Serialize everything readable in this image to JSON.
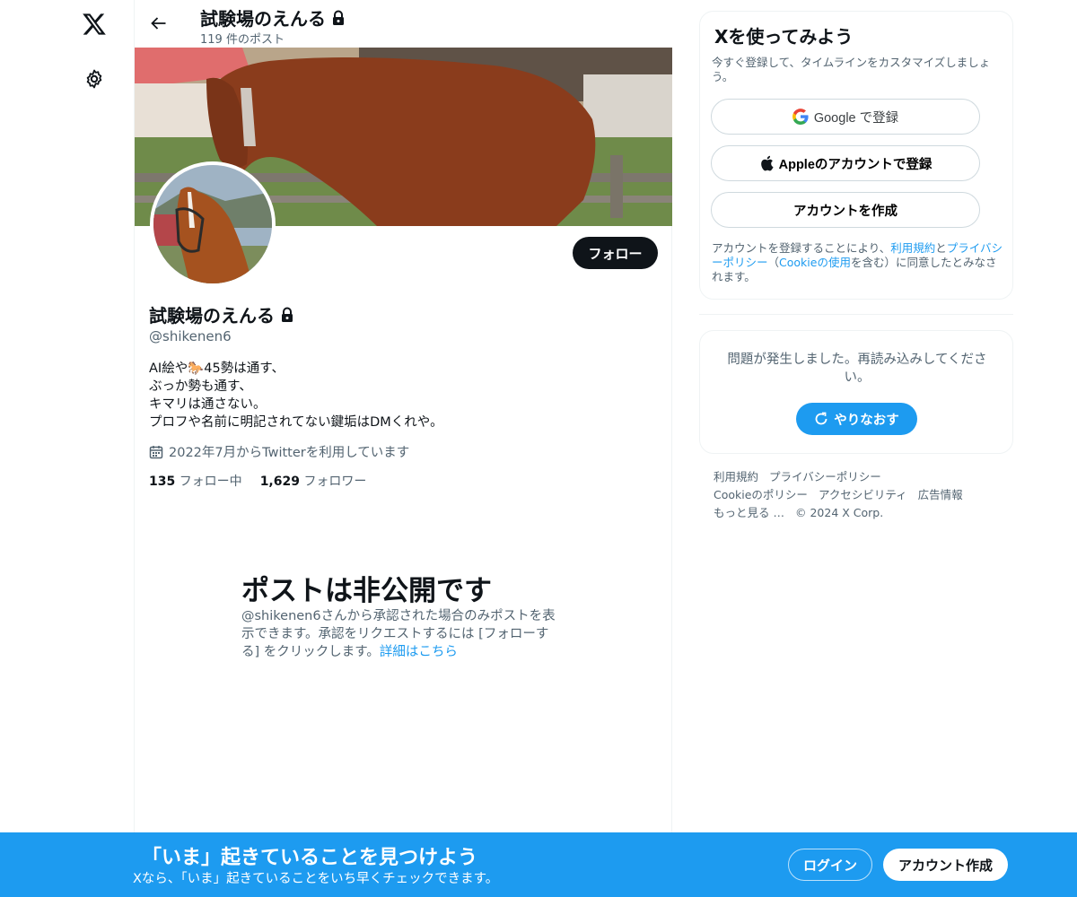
{
  "nav": {
    "logo_icon": "x-logo-icon",
    "settings_icon": "gear-icon"
  },
  "header": {
    "title": "試験場のえんる",
    "post_count": "119 件のポスト",
    "lock_icon": "lock-icon",
    "back_icon": "arrow-left-icon"
  },
  "profile": {
    "name": "試験場のえんる",
    "handle": "@shikenen6",
    "follow_label": "フォロー",
    "bio": [
      "AI絵や🐎45勢は通す、",
      "ぶっか勢も通す、",
      "キマリは通さない。",
      "プロフや名前に明記されてない鍵垢はDMくれや。"
    ],
    "joined": "2022年7月からTwitterを利用しています",
    "following_count": "135",
    "following_label": "フォロー中",
    "followers_count": "1,629",
    "followers_label": "フォロワー"
  },
  "private": {
    "title": "ポストは非公開です",
    "desc": "@shikenen6さんから承認された場合のみポストを表示できます。承認をリクエストするには [フォローする] をクリックします。",
    "link": "詳細はこちら"
  },
  "signup": {
    "title": "Xを使ってみよう",
    "subtitle": "今すぐ登録して、タイムラインをカスタマイズしましょう。",
    "google_label": "Google で登録",
    "apple_label": "Appleのアカウントで登録",
    "create_label": "アカウントを作成",
    "terms_pre": "アカウントを登録することにより、",
    "terms_link1": "利用規約",
    "terms_and": "と",
    "terms_link2": "プライバシーポリシー",
    "terms_mid": "（",
    "terms_link3": "Cookieの使用",
    "terms_post": "を含む）に同意したとみなされます。"
  },
  "error": {
    "message": "問題が発生しました。再読み込みしてください。",
    "retry_label": "やりなおす"
  },
  "footer": {
    "links": [
      "利用規約",
      "プライバシーポリシー",
      "Cookieのポリシー",
      "アクセシビリティ",
      "広告情報",
      "もっと見る …"
    ],
    "copyright": "© 2024 X Corp."
  },
  "bottom_bar": {
    "title": "「いま」起きていることを見つけよう",
    "subtitle": "Xなら、「いま」起きていることをいち早くチェックできます。",
    "login_label": "ログイン",
    "create_label": "アカウント作成"
  },
  "colors": {
    "accent": "#1d9bf0",
    "text": "#0f1419",
    "muted": "#536471"
  }
}
